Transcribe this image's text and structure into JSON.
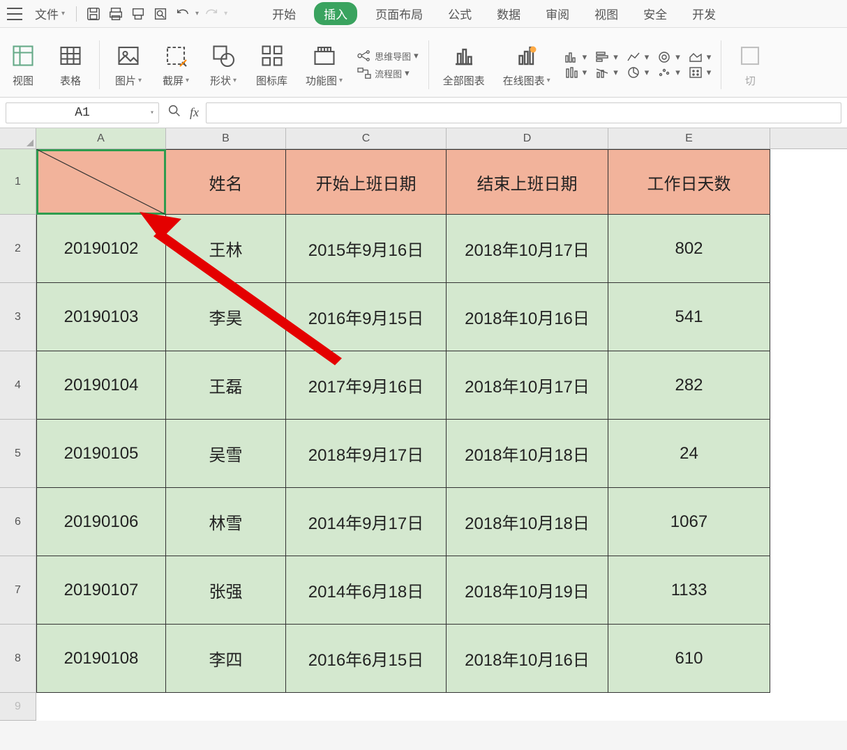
{
  "menu": {
    "file": "文件",
    "tabs": [
      "开始",
      "插入",
      "页面布局",
      "公式",
      "数据",
      "审阅",
      "视图",
      "安全",
      "开发"
    ],
    "active_tab_index": 1
  },
  "ribbon": {
    "pivot_label": "视图",
    "table_label": "表格",
    "picture_label": "图片",
    "crop_label": "截屏",
    "shape_label": "形状",
    "icons_label": "图标库",
    "function_label": "功能图",
    "mindmap_label": "思维导图",
    "flowchart_label": "流程图",
    "allcharts_label": "全部图表",
    "onlinecharts_label": "在线图表",
    "cut_label": "切"
  },
  "refbar": {
    "cell": "A1"
  },
  "columns": [
    "A",
    "B",
    "C",
    "D",
    "E"
  ],
  "header_row": [
    "",
    "姓名",
    "开始上班日期",
    "结束上班日期",
    "工作日天数"
  ],
  "rows": [
    [
      "20190102",
      "王林",
      "2015年9月16日",
      "2018年10月17日",
      "802"
    ],
    [
      "20190103",
      "李昊",
      "2016年9月15日",
      "2018年10月16日",
      "541"
    ],
    [
      "20190104",
      "王磊",
      "2017年9月16日",
      "2018年10月17日",
      "282"
    ],
    [
      "20190105",
      "吴雪",
      "2018年9月17日",
      "2018年10月18日",
      "24"
    ],
    [
      "20190106",
      "林雪",
      "2014年9月17日",
      "2018年10月18日",
      "1067"
    ],
    [
      "20190107",
      "张强",
      "2014年6月18日",
      "2018年10月19日",
      "1133"
    ],
    [
      "20190108",
      "李四",
      "2016年6月15日",
      "2018年10月16日",
      "610"
    ]
  ],
  "row_heights": {
    "header": 94,
    "data": 98
  }
}
